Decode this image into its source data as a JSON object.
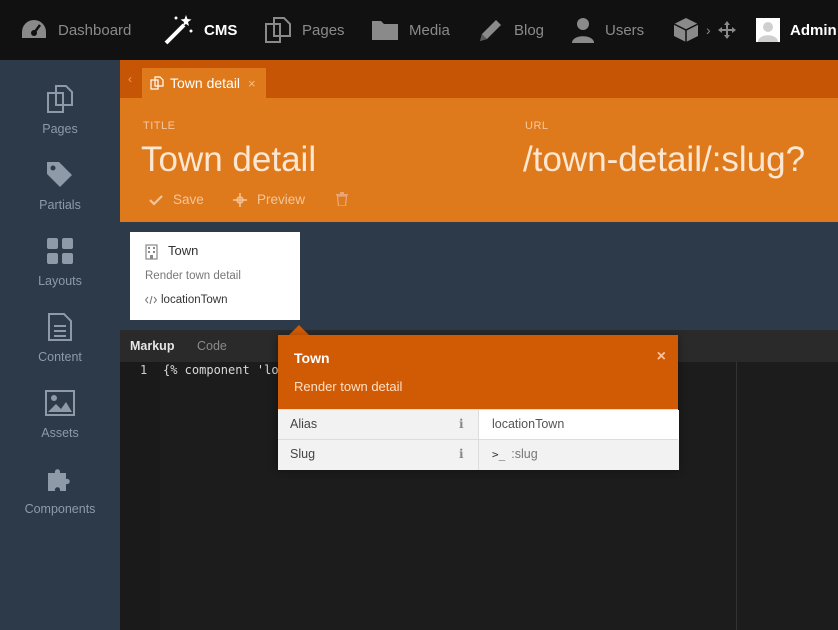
{
  "nav": {
    "items": [
      {
        "label": "Dashboard",
        "icon": "dashboard-icon"
      },
      {
        "label": "CMS",
        "icon": "magic-wand-icon"
      },
      {
        "label": "Pages",
        "icon": "pages-icon"
      },
      {
        "label": "Media",
        "icon": "folder-icon"
      },
      {
        "label": "Blog",
        "icon": "pencil-icon"
      },
      {
        "label": "Users",
        "icon": "user-icon"
      }
    ],
    "more_chevron": "›",
    "admin_label": "Admin"
  },
  "sidebar": {
    "items": [
      {
        "label": "Pages",
        "icon": "pages-icon"
      },
      {
        "label": "Partials",
        "icon": "tags-icon"
      },
      {
        "label": "Layouts",
        "icon": "grid-icon"
      },
      {
        "label": "Content",
        "icon": "file-text-icon"
      },
      {
        "label": "Assets",
        "icon": "image-icon"
      },
      {
        "label": "Components",
        "icon": "puzzle-icon"
      }
    ]
  },
  "tabs": {
    "back_arrow": "‹",
    "active": {
      "label": "Town detail",
      "close": "×"
    }
  },
  "form": {
    "title_label": "TITLE",
    "title_value": "Town detail",
    "url_label": "URL",
    "url_value": "/town-detail/:slug?",
    "save_label": "Save",
    "preview_label": "Preview"
  },
  "component_card": {
    "title": "Town",
    "description": "Render town detail",
    "alias": "locationTown"
  },
  "editor": {
    "tabs": [
      "Markup",
      "Code"
    ],
    "lines": [
      {
        "number": "1",
        "text": "{% component 'lo"
      }
    ]
  },
  "popup": {
    "title": "Town",
    "description": "Render town detail",
    "close": "×",
    "rows": [
      {
        "key": "Alias",
        "info": "i",
        "value": "locationTown"
      },
      {
        "key": "Slug",
        "info": "i",
        "value_prefix": ">_",
        "value": ":slug"
      }
    ]
  },
  "colors": {
    "accent": "#de7a1c",
    "accent_dark": "#c75506",
    "popup_header": "#d15a05",
    "sidebar": "#2c3a4a",
    "topbar": "#111111"
  }
}
